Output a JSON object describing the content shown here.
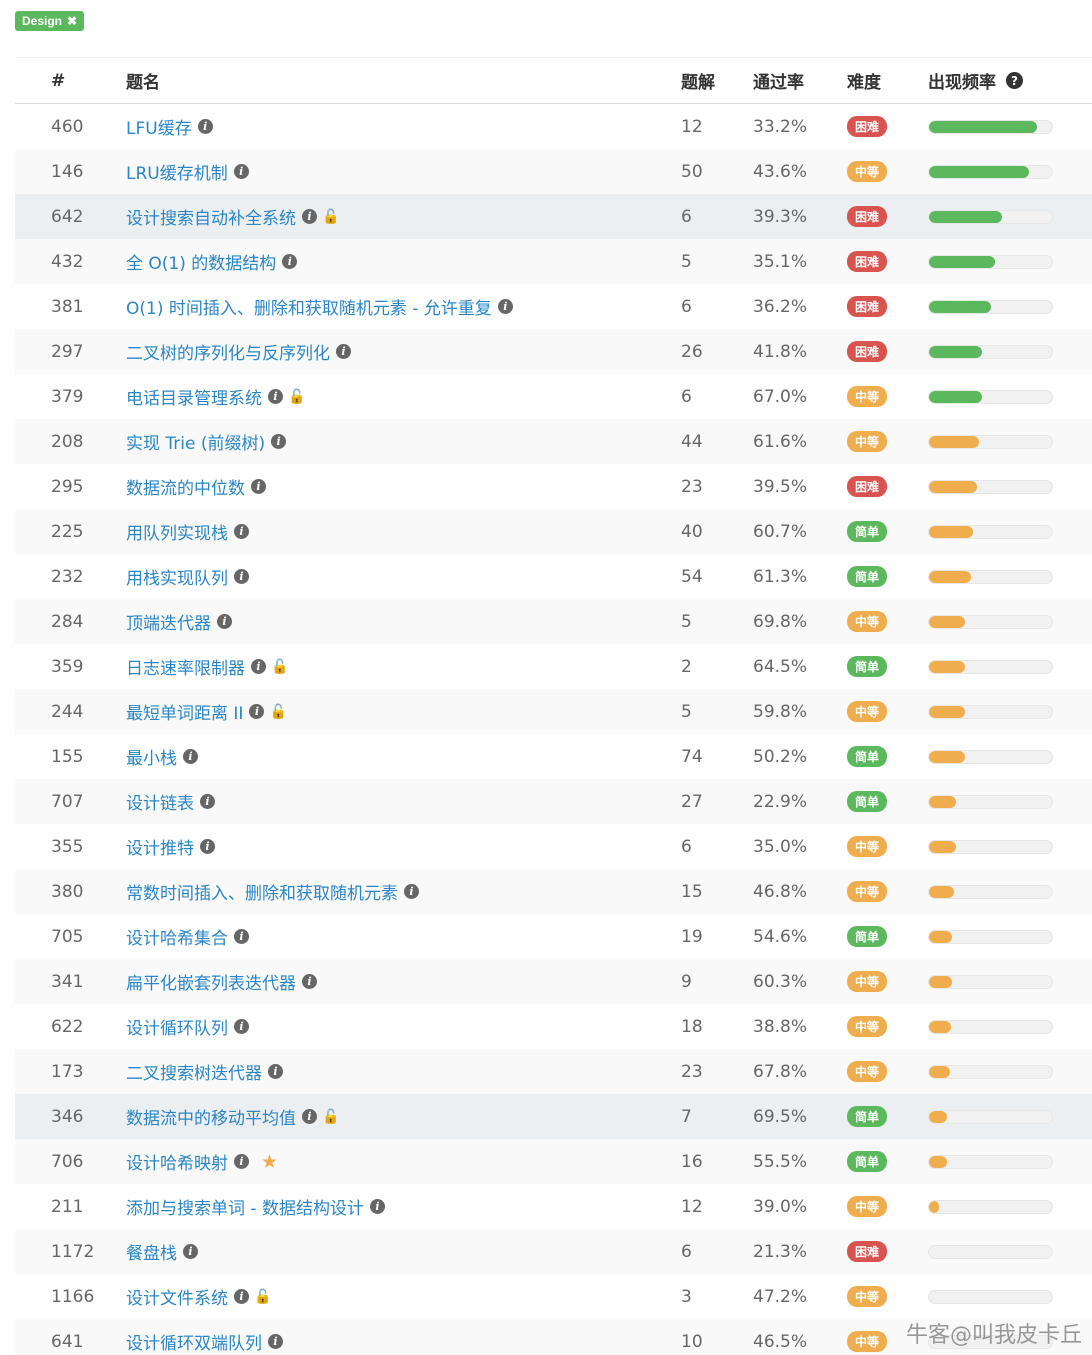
{
  "filter": {
    "label": "Design",
    "close": "✖"
  },
  "headers": {
    "id": "#",
    "title": "题名",
    "solutions": "题解",
    "acceptance": "通过率",
    "difficulty": "难度",
    "frequency": "出现频率"
  },
  "difficulty_colors": {
    "困难": "#d9534f",
    "中等": "#f0ad4e",
    "简单": "#5cb85c"
  },
  "rows": [
    {
      "id": "460",
      "title": "LFU缓存",
      "lock": false,
      "star": false,
      "solutions": "12",
      "rate": "33.2%",
      "difficulty": "困难",
      "freq": 0.88,
      "color": "#5cb85c"
    },
    {
      "id": "146",
      "title": "LRU缓存机制",
      "lock": false,
      "star": false,
      "solutions": "50",
      "rate": "43.6%",
      "difficulty": "中等",
      "freq": 0.81,
      "color": "#5cb85c"
    },
    {
      "id": "642",
      "title": "设计搜索自动补全系统",
      "lock": true,
      "star": false,
      "solutions": "6",
      "rate": "39.3%",
      "difficulty": "困难",
      "freq": 0.59,
      "color": "#5cb85c",
      "hl": true
    },
    {
      "id": "432",
      "title": "全 O(1) 的数据结构",
      "lock": false,
      "star": false,
      "solutions": "5",
      "rate": "35.1%",
      "difficulty": "困难",
      "freq": 0.54,
      "color": "#5cb85c"
    },
    {
      "id": "381",
      "title": "O(1) 时间插入、删除和获取随机元素 - 允许重复",
      "lock": false,
      "star": false,
      "solutions": "6",
      "rate": "36.2%",
      "difficulty": "困难",
      "freq": 0.5,
      "color": "#5cb85c"
    },
    {
      "id": "297",
      "title": "二叉树的序列化与反序列化",
      "lock": false,
      "star": false,
      "solutions": "26",
      "rate": "41.8%",
      "difficulty": "困难",
      "freq": 0.43,
      "color": "#5cb85c"
    },
    {
      "id": "379",
      "title": "电话目录管理系统",
      "lock": true,
      "star": false,
      "solutions": "6",
      "rate": "67.0%",
      "difficulty": "中等",
      "freq": 0.43,
      "color": "#5cb85c"
    },
    {
      "id": "208",
      "title": "实现 Trie (前缀树)",
      "lock": false,
      "star": false,
      "solutions": "44",
      "rate": "61.6%",
      "difficulty": "中等",
      "freq": 0.41,
      "color": "#f0ad4e"
    },
    {
      "id": "295",
      "title": "数据流的中位数",
      "lock": false,
      "star": false,
      "solutions": "23",
      "rate": "39.5%",
      "difficulty": "困难",
      "freq": 0.39,
      "color": "#f0ad4e"
    },
    {
      "id": "225",
      "title": "用队列实现栈",
      "lock": false,
      "star": false,
      "solutions": "40",
      "rate": "60.7%",
      "difficulty": "简单",
      "freq": 0.36,
      "color": "#f0ad4e"
    },
    {
      "id": "232",
      "title": "用栈实现队列",
      "lock": false,
      "star": false,
      "solutions": "54",
      "rate": "61.3%",
      "difficulty": "简单",
      "freq": 0.34,
      "color": "#f0ad4e"
    },
    {
      "id": "284",
      "title": "顶端迭代器",
      "lock": false,
      "star": false,
      "solutions": "5",
      "rate": "69.8%",
      "difficulty": "中等",
      "freq": 0.29,
      "color": "#f0ad4e"
    },
    {
      "id": "359",
      "title": "日志速率限制器",
      "lock": true,
      "star": false,
      "solutions": "2",
      "rate": "64.5%",
      "difficulty": "简单",
      "freq": 0.29,
      "color": "#f0ad4e"
    },
    {
      "id": "244",
      "title": "最短单词距离 II",
      "lock": true,
      "star": false,
      "solutions": "5",
      "rate": "59.8%",
      "difficulty": "中等",
      "freq": 0.29,
      "color": "#f0ad4e"
    },
    {
      "id": "155",
      "title": "最小栈",
      "lock": false,
      "star": false,
      "solutions": "74",
      "rate": "50.2%",
      "difficulty": "简单",
      "freq": 0.29,
      "color": "#f0ad4e"
    },
    {
      "id": "707",
      "title": "设计链表",
      "lock": false,
      "star": false,
      "solutions": "27",
      "rate": "22.9%",
      "difficulty": "简单",
      "freq": 0.22,
      "color": "#f0ad4e"
    },
    {
      "id": "355",
      "title": "设计推特",
      "lock": false,
      "star": false,
      "solutions": "6",
      "rate": "35.0%",
      "difficulty": "中等",
      "freq": 0.22,
      "color": "#f0ad4e"
    },
    {
      "id": "380",
      "title": "常数时间插入、删除和获取随机元素",
      "lock": false,
      "star": false,
      "solutions": "15",
      "rate": "46.8%",
      "difficulty": "中等",
      "freq": 0.2,
      "color": "#f0ad4e"
    },
    {
      "id": "705",
      "title": "设计哈希集合",
      "lock": false,
      "star": false,
      "solutions": "19",
      "rate": "54.6%",
      "difficulty": "简单",
      "freq": 0.19,
      "color": "#f0ad4e"
    },
    {
      "id": "341",
      "title": "扁平化嵌套列表迭代器",
      "lock": false,
      "star": false,
      "solutions": "9",
      "rate": "60.3%",
      "difficulty": "中等",
      "freq": 0.19,
      "color": "#f0ad4e"
    },
    {
      "id": "622",
      "title": "设计循环队列",
      "lock": false,
      "star": false,
      "solutions": "18",
      "rate": "38.8%",
      "difficulty": "中等",
      "freq": 0.18,
      "color": "#f0ad4e"
    },
    {
      "id": "173",
      "title": "二叉搜索树迭代器",
      "lock": false,
      "star": false,
      "solutions": "23",
      "rate": "67.8%",
      "difficulty": "中等",
      "freq": 0.17,
      "color": "#f0ad4e"
    },
    {
      "id": "346",
      "title": "数据流中的移动平均值",
      "lock": true,
      "star": false,
      "solutions": "7",
      "rate": "69.5%",
      "difficulty": "简单",
      "freq": 0.15,
      "color": "#f0ad4e",
      "hl": true
    },
    {
      "id": "706",
      "title": "设计哈希映射",
      "lock": false,
      "star": true,
      "solutions": "16",
      "rate": "55.5%",
      "difficulty": "简单",
      "freq": 0.15,
      "color": "#f0ad4e"
    },
    {
      "id": "211",
      "title": "添加与搜索单词 - 数据结构设计",
      "lock": false,
      "star": false,
      "solutions": "12",
      "rate": "39.0%",
      "difficulty": "中等",
      "freq": 0.08,
      "color": "#f0ad4e"
    },
    {
      "id": "1172",
      "title": "餐盘栈",
      "lock": false,
      "star": false,
      "solutions": "6",
      "rate": "21.3%",
      "difficulty": "困难",
      "freq": 0,
      "color": "#f0ad4e"
    },
    {
      "id": "1166",
      "title": "设计文件系统",
      "lock": true,
      "star": false,
      "solutions": "3",
      "rate": "47.2%",
      "difficulty": "中等",
      "freq": 0,
      "color": "#f0ad4e"
    },
    {
      "id": "641",
      "title": "设计循环双端队列",
      "lock": false,
      "star": false,
      "solutions": "10",
      "rate": "46.5%",
      "difficulty": "中等",
      "freq": 0,
      "color": "#f0ad4e"
    }
  ],
  "watermark": "牛客@叫我皮卡丘"
}
